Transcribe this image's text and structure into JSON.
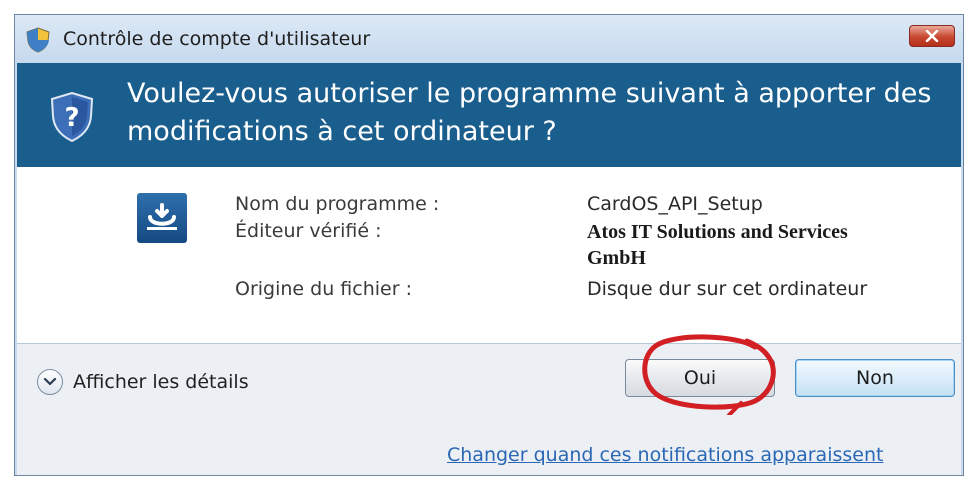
{
  "window": {
    "title": "Contrôle de compte d'utilisateur",
    "title_icon": "shield-icon",
    "close_icon": "close-icon"
  },
  "header": {
    "question": "Voulez-vous autoriser le programme suivant à apporter des modifications à cet ordinateur ?",
    "icon": "shield-question-icon",
    "background_color": "#1a5e8e"
  },
  "details": {
    "program_icon": "installer-icon",
    "program_name_label": "Nom du programme :",
    "program_name_value": "CardOS_API_Setup",
    "publisher_label": "Éditeur vérifié :",
    "publisher_value": "Atos IT Solutions and Services GmbH",
    "origin_label": "Origine du fichier :",
    "origin_value": "Disque dur sur cet ordinateur"
  },
  "footer": {
    "show_details_label": "Afficher les détails",
    "show_details_icon": "chevron-down-icon",
    "yes_label": "Oui",
    "no_label": "Non",
    "notification_link": "Changer quand ces notifications apparaissent",
    "link_color": "#2a67b5"
  }
}
